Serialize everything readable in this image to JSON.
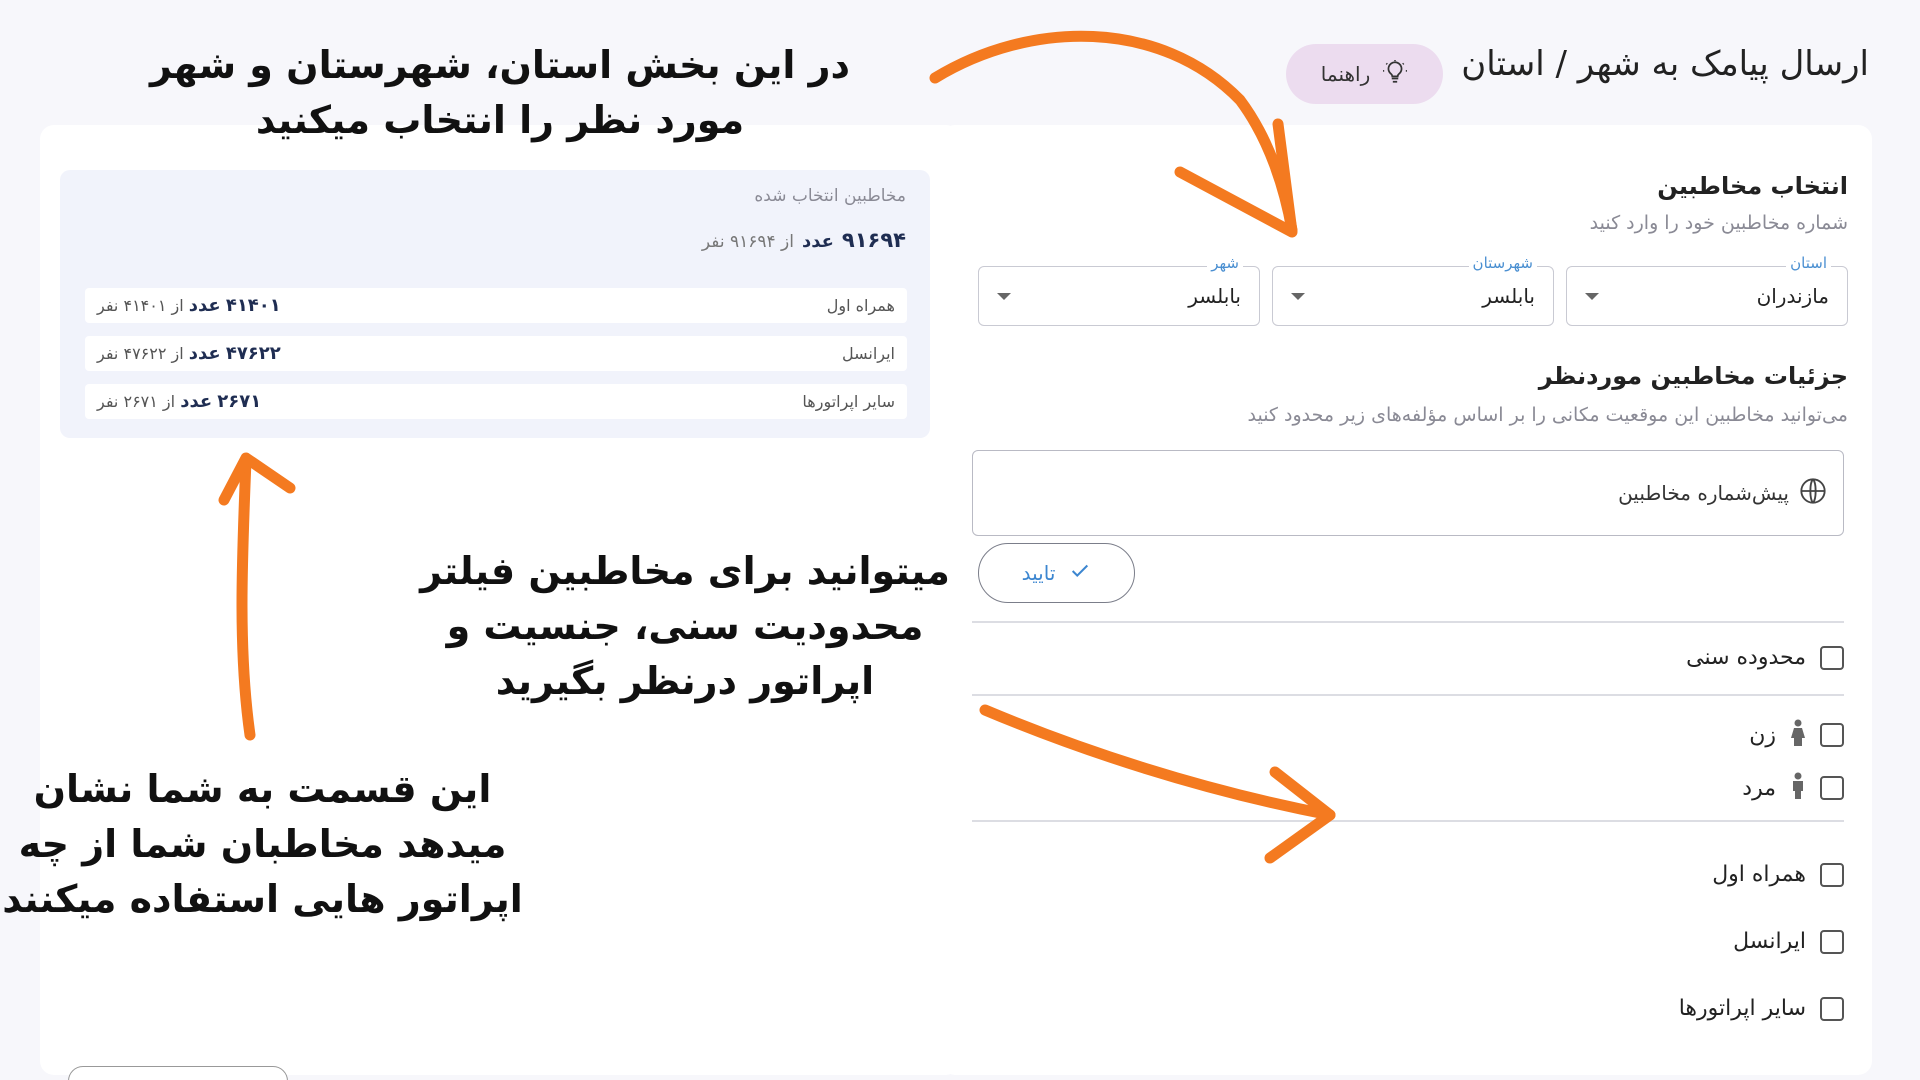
{
  "header": {
    "title": "ارسال پیامک به شهر / استان",
    "guide_label": "راهنما"
  },
  "audience": {
    "title": "انتخاب مخاطبین",
    "subtitle": "شماره مخاطبین خود را وارد کنید",
    "province": {
      "legend": "استان",
      "value": "مازندران"
    },
    "county": {
      "legend": "شهرستان",
      "value": "بابلسر"
    },
    "city": {
      "legend": "شهر",
      "value": "بابلسر"
    }
  },
  "details": {
    "title": "جزئیات مخاطبین موردنظر",
    "subtitle": "می‌توانید مخاطبین این موقعیت مکانی را بر اساس مؤلفه‌های زیر محدود کنید",
    "prefix_label": "پیش‌شماره مخاطبین",
    "confirm_label": "تایید"
  },
  "filters": {
    "age": "محدوده سنی",
    "female": "زن",
    "male": "مرد",
    "mci": "همراه اول",
    "irancell": "ایرانسل",
    "other": "سایر اپراتورها"
  },
  "summary": {
    "title": "مخاطبین انتخاب شده",
    "total_count": "۹۱۶۹۴",
    "total_unit": "عدد",
    "total_of": "از ۹۱۶۹۴ نفر",
    "rows": [
      {
        "operator": "همراه اول",
        "count": "۴۱۴۰۱",
        "unit": "عدد",
        "of": "از ۴۱۴۰۱ نفر"
      },
      {
        "operator": "ایرانسل",
        "count": "۴۷۶۲۲",
        "unit": "عدد",
        "of": "از ۴۷۶۲۲ نفر"
      },
      {
        "operator": "سایر اپراتورها",
        "count": "۲۶۷۱",
        "unit": "عدد",
        "of": "از ۲۶۷۱ نفر"
      }
    ]
  },
  "annotations": {
    "top_line1": "در این بخش استان، شهرستان و شهر",
    "top_line2": "مورد نظر را انتخاب میکنید",
    "middle_line1": "میتوانید برای مخاطبین فیلتر",
    "middle_line2": "محدودیت سنی، جنسیت و",
    "middle_line3": "اپراتور درنظر بگیرید",
    "bottom_line1": "این قسمت به شما نشان",
    "bottom_line2": "میدهد مخاطبان شما از چه",
    "bottom_line3": "اپراتور هایی استفاده میکنند"
  },
  "colors": {
    "accent": "#3c86d0",
    "arrow": "#f47a20",
    "guide_bg": "#ecdcef"
  }
}
